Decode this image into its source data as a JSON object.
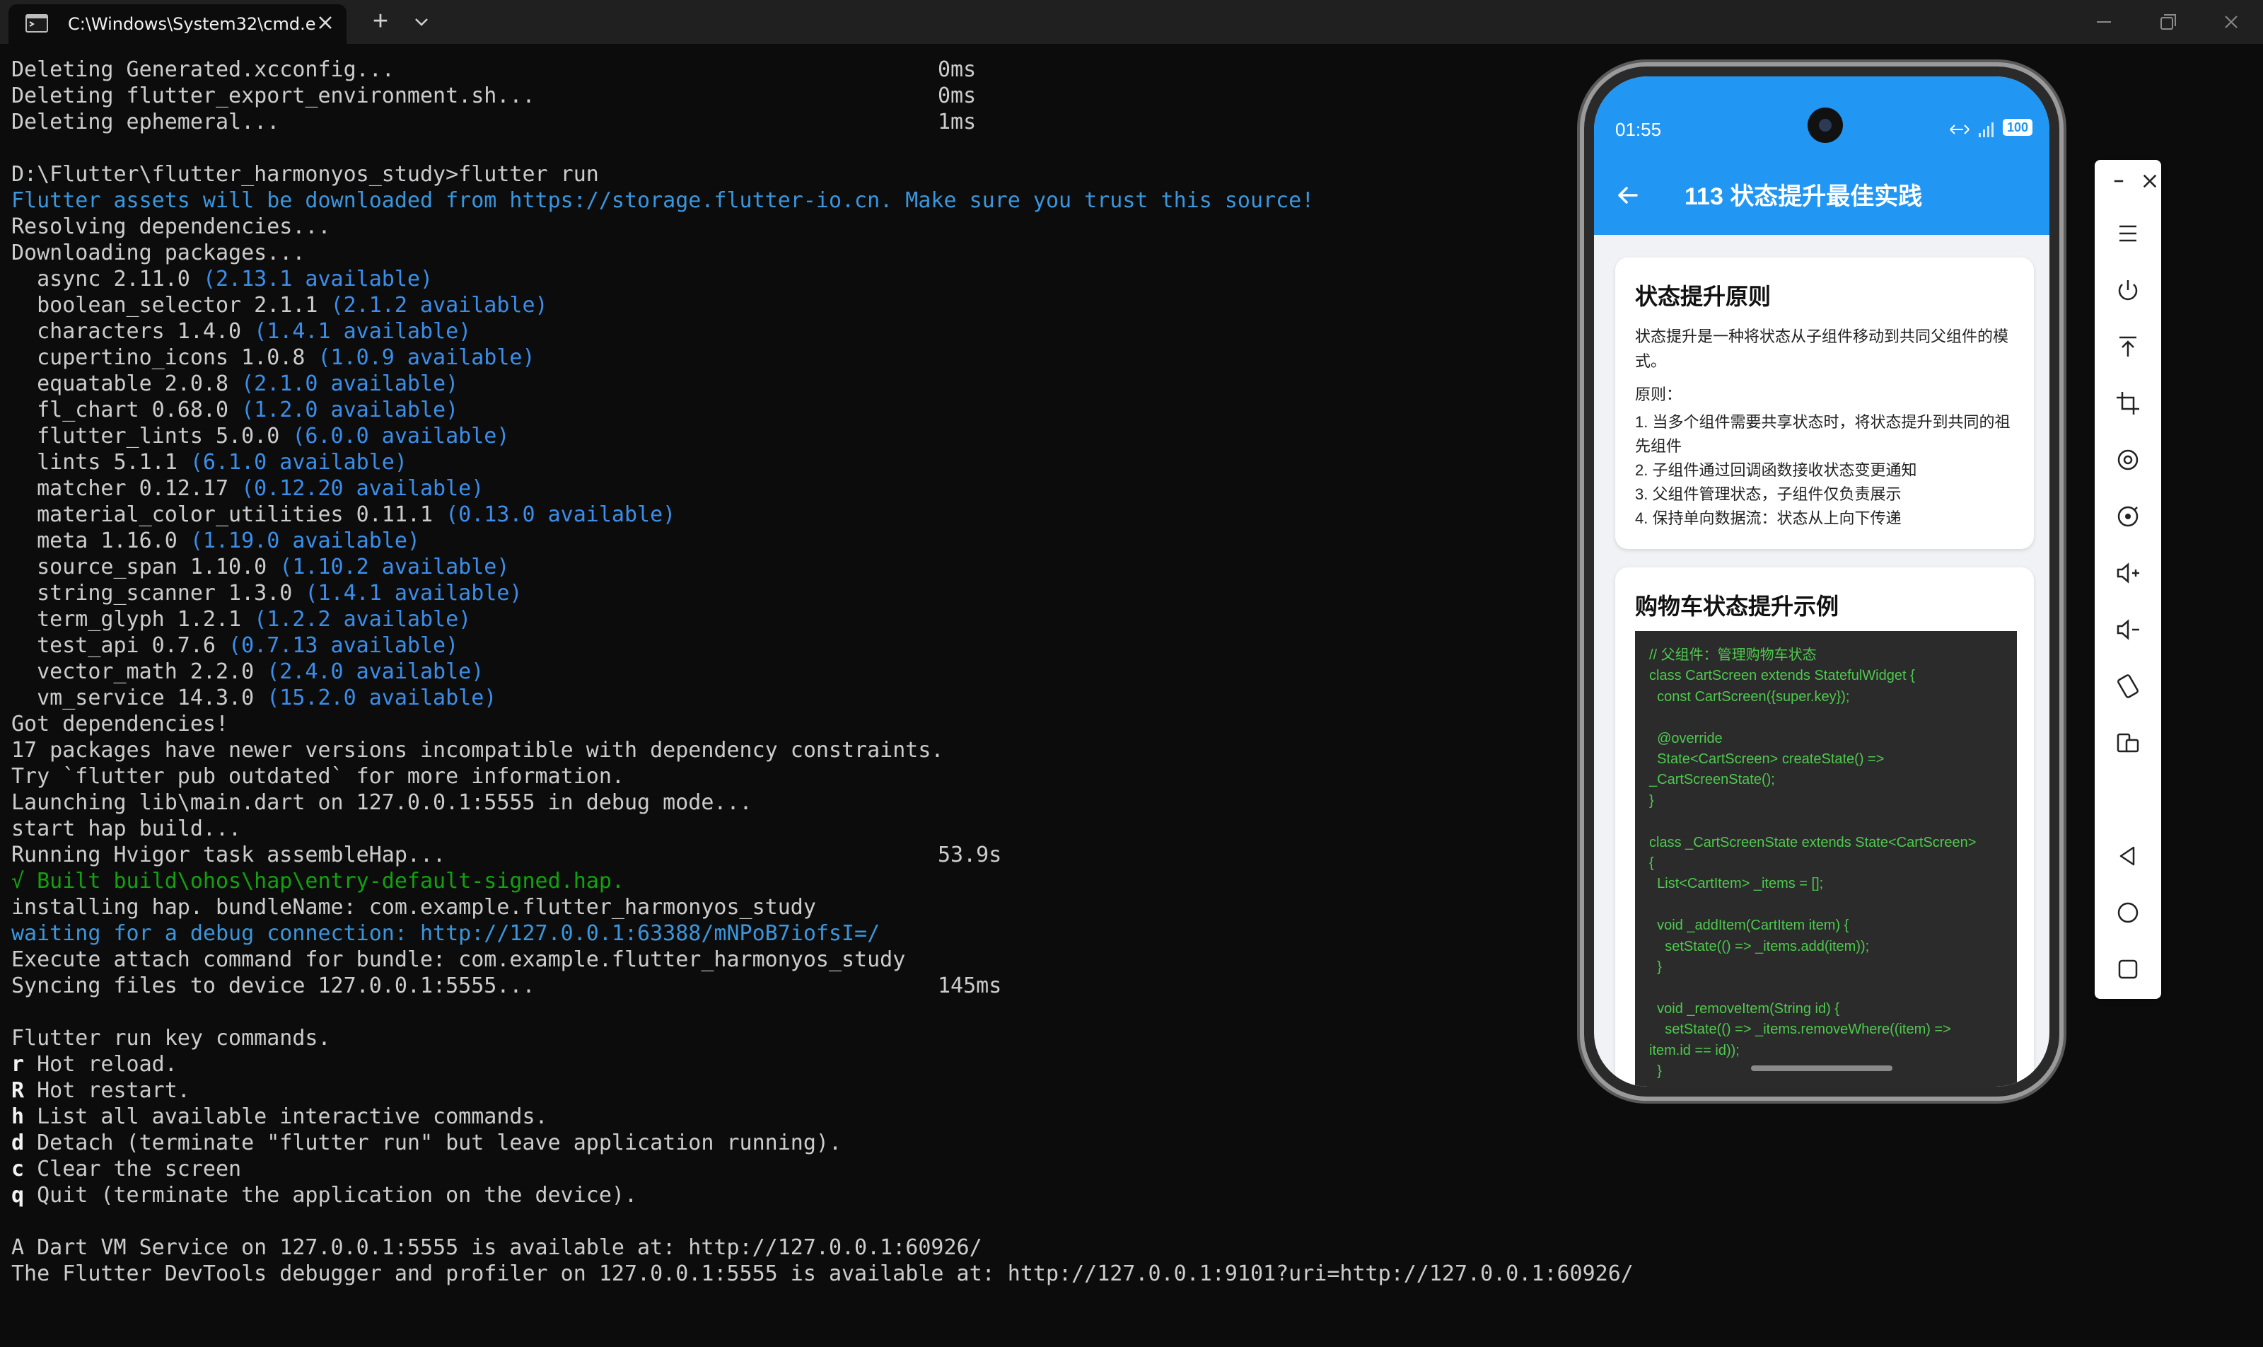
{
  "window": {
    "tab_title": "C:\\Windows\\System32\\cmd.e",
    "tab_icon": "terminal-icon",
    "close_tab_icon": "close-icon",
    "new_tab_label": "+",
    "dropdown_icon": "chevron-down-icon",
    "minimize_icon": "minimize-icon",
    "maximize_icon": "maximize-icon",
    "close_icon": "close-icon"
  },
  "terminal": {
    "colors": {
      "text": "#cccccc",
      "cyan": "#3a96dd",
      "green": "#13a10e",
      "bright": "#f2f2f2",
      "available": "#3b8eea",
      "background": "#0c0c0c"
    },
    "lines": [
      {
        "segments": [
          {
            "text": "Deleting Generated.xcconfig...",
            "style": ""
          }
        ],
        "time": "0ms"
      },
      {
        "segments": [
          {
            "text": "Deleting flutter_export_environment.sh...",
            "style": ""
          }
        ],
        "time": "0ms"
      },
      {
        "segments": [
          {
            "text": "Deleting ephemeral...",
            "style": ""
          }
        ],
        "time": "1ms"
      },
      {
        "segments": [
          {
            "text": "",
            "style": ""
          }
        ],
        "time": ""
      },
      {
        "segments": [
          {
            "text": "D:\\Flutter\\flutter_harmonyos_study>flutter run",
            "style": ""
          }
        ],
        "time": ""
      },
      {
        "segments": [
          {
            "text": "Flutter assets will be downloaded from https://storage.flutter-io.cn. Make sure you trust this source!",
            "style": "cyan"
          }
        ],
        "time": ""
      },
      {
        "segments": [
          {
            "text": "Resolving dependencies...",
            "style": ""
          }
        ],
        "time": ""
      },
      {
        "segments": [
          {
            "text": "Downloading packages...",
            "style": ""
          }
        ],
        "time": ""
      },
      {
        "segments": [
          {
            "text": "  async 2.11.0 ",
            "style": ""
          },
          {
            "text": "(2.13.1 available)",
            "style": "avail"
          }
        ],
        "time": ""
      },
      {
        "segments": [
          {
            "text": "  boolean_selector 2.1.1 ",
            "style": ""
          },
          {
            "text": "(2.1.2 available)",
            "style": "avail"
          }
        ],
        "time": ""
      },
      {
        "segments": [
          {
            "text": "  characters 1.4.0 ",
            "style": ""
          },
          {
            "text": "(1.4.1 available)",
            "style": "avail"
          }
        ],
        "time": ""
      },
      {
        "segments": [
          {
            "text": "  cupertino_icons 1.0.8 ",
            "style": ""
          },
          {
            "text": "(1.0.9 available)",
            "style": "avail"
          }
        ],
        "time": ""
      },
      {
        "segments": [
          {
            "text": "  equatable 2.0.8 ",
            "style": ""
          },
          {
            "text": "(2.1.0 available)",
            "style": "avail"
          }
        ],
        "time": ""
      },
      {
        "segments": [
          {
            "text": "  fl_chart 0.68.0 ",
            "style": ""
          },
          {
            "text": "(1.2.0 available)",
            "style": "avail"
          }
        ],
        "time": ""
      },
      {
        "segments": [
          {
            "text": "  flutter_lints 5.0.0 ",
            "style": ""
          },
          {
            "text": "(6.0.0 available)",
            "style": "avail"
          }
        ],
        "time": ""
      },
      {
        "segments": [
          {
            "text": "  lints 5.1.1 ",
            "style": ""
          },
          {
            "text": "(6.1.0 available)",
            "style": "avail"
          }
        ],
        "time": ""
      },
      {
        "segments": [
          {
            "text": "  matcher 0.12.17 ",
            "style": ""
          },
          {
            "text": "(0.12.20 available)",
            "style": "avail"
          }
        ],
        "time": ""
      },
      {
        "segments": [
          {
            "text": "  material_color_utilities 0.11.1 ",
            "style": ""
          },
          {
            "text": "(0.13.0 available)",
            "style": "avail"
          }
        ],
        "time": ""
      },
      {
        "segments": [
          {
            "text": "  meta 1.16.0 ",
            "style": ""
          },
          {
            "text": "(1.19.0 available)",
            "style": "avail"
          }
        ],
        "time": ""
      },
      {
        "segments": [
          {
            "text": "  source_span 1.10.0 ",
            "style": ""
          },
          {
            "text": "(1.10.2 available)",
            "style": "avail"
          }
        ],
        "time": ""
      },
      {
        "segments": [
          {
            "text": "  string_scanner 1.3.0 ",
            "style": ""
          },
          {
            "text": "(1.4.1 available)",
            "style": "avail"
          }
        ],
        "time": ""
      },
      {
        "segments": [
          {
            "text": "  term_glyph 1.2.1 ",
            "style": ""
          },
          {
            "text": "(1.2.2 available)",
            "style": "avail"
          }
        ],
        "time": ""
      },
      {
        "segments": [
          {
            "text": "  test_api 0.7.6 ",
            "style": ""
          },
          {
            "text": "(0.7.13 available)",
            "style": "avail"
          }
        ],
        "time": ""
      },
      {
        "segments": [
          {
            "text": "  vector_math 2.2.0 ",
            "style": ""
          },
          {
            "text": "(2.4.0 available)",
            "style": "avail"
          }
        ],
        "time": ""
      },
      {
        "segments": [
          {
            "text": "  vm_service 14.3.0 ",
            "style": ""
          },
          {
            "text": "(15.2.0 available)",
            "style": "avail"
          }
        ],
        "time": ""
      },
      {
        "segments": [
          {
            "text": "Got dependencies!",
            "style": ""
          }
        ],
        "time": ""
      },
      {
        "segments": [
          {
            "text": "17 packages have newer versions incompatible with dependency constraints.",
            "style": ""
          }
        ],
        "time": ""
      },
      {
        "segments": [
          {
            "text": "Try `flutter pub outdated` for more information.",
            "style": ""
          }
        ],
        "time": ""
      },
      {
        "segments": [
          {
            "text": "Launching lib\\main.dart on 127.0.0.1:5555 in debug mode...",
            "style": ""
          }
        ],
        "time": ""
      },
      {
        "segments": [
          {
            "text": "start hap build...",
            "style": ""
          }
        ],
        "time": ""
      },
      {
        "segments": [
          {
            "text": "Running Hvigor task assembleHap...",
            "style": ""
          }
        ],
        "time": "53.9s"
      },
      {
        "segments": [
          {
            "text": "√ Built build\\ohos\\hap\\entry-default-signed.hap.",
            "style": "green"
          }
        ],
        "time": ""
      },
      {
        "segments": [
          {
            "text": "installing hap. bundleName: com.example.flutter_harmonyos_study",
            "style": ""
          }
        ],
        "time": ""
      },
      {
        "segments": [
          {
            "text": "waiting for a debug connection: http://127.0.0.1:63388/mNPoB7iofsI=/",
            "style": "cyan"
          }
        ],
        "time": ""
      },
      {
        "segments": [
          {
            "text": "Execute attach command for bundle: com.example.flutter_harmonyos_study",
            "style": ""
          }
        ],
        "time": ""
      },
      {
        "segments": [
          {
            "text": "Syncing files to device 127.0.0.1:5555...",
            "style": ""
          }
        ],
        "time": "145ms"
      },
      {
        "segments": [
          {
            "text": "",
            "style": ""
          }
        ],
        "time": ""
      },
      {
        "segments": [
          {
            "text": "Flutter run key commands.",
            "style": ""
          }
        ],
        "time": ""
      },
      {
        "segments": [
          {
            "text": "r",
            "style": "bright"
          },
          {
            "text": " Hot reload.",
            "style": ""
          }
        ],
        "time": ""
      },
      {
        "segments": [
          {
            "text": "R",
            "style": "bright"
          },
          {
            "text": " Hot restart.",
            "style": ""
          }
        ],
        "time": ""
      },
      {
        "segments": [
          {
            "text": "h",
            "style": "bright"
          },
          {
            "text": " List all available interactive commands.",
            "style": ""
          }
        ],
        "time": ""
      },
      {
        "segments": [
          {
            "text": "d",
            "style": "bright"
          },
          {
            "text": " Detach (terminate \"flutter run\" but leave application running).",
            "style": ""
          }
        ],
        "time": ""
      },
      {
        "segments": [
          {
            "text": "c",
            "style": "bright"
          },
          {
            "text": " Clear the screen",
            "style": ""
          }
        ],
        "time": ""
      },
      {
        "segments": [
          {
            "text": "q",
            "style": "bright"
          },
          {
            "text": " Quit (terminate the application on the device).",
            "style": ""
          }
        ],
        "time": ""
      },
      {
        "segments": [
          {
            "text": "",
            "style": ""
          }
        ],
        "time": ""
      },
      {
        "segments": [
          {
            "text": "A Dart VM Service on 127.0.0.1:5555 is available at: http://127.0.0.1:60926/",
            "style": ""
          }
        ],
        "time": ""
      },
      {
        "segments": [
          {
            "text": "The Flutter DevTools debugger and profiler on 127.0.0.1:5555 is available at: http://127.0.0.1:9101?uri=http://127.0.0.1:60926/",
            "style": ""
          }
        ],
        "time": ""
      }
    ]
  },
  "phone": {
    "status_time": "01:55",
    "battery": "100",
    "accent_color": "#2196f3",
    "app_title": "113 状态提升最佳实践",
    "back_icon": "arrow-left-icon",
    "card1": {
      "title": "状态提升原则",
      "intro": "状态提升是一种将状态从子组件移动到共同父组件的模式。",
      "rules_heading": "原则：",
      "rules": [
        "1. 当多个组件需要共享状态时，将状态提升到共同的祖先组件",
        "2. 子组件通过回调函数接收状态变更通知",
        "3. 父组件管理状态，子组件仅负责展示",
        "4. 保持单向数据流：状态从上向下传递"
      ]
    },
    "card2": {
      "title": "购物车状态提升示例",
      "code_color": "#4ec94e",
      "code": "// 父组件：管理购物车状态\nclass CartScreen extends StatefulWidget {\n  const CartScreen({super.key});\n\n  @override\n  State<CartScreen> createState() =>\n_CartScreenState();\n}\n\nclass _CartScreenState extends State<CartScreen>\n{\n  List<CartItem> _items = [];\n\n  void _addItem(CartItem item) {\n    setState(() => _items.add(item));\n  }\n\n  void _removeItem(String id) {\n    setState(() => _items.removeWhere((item) =>\nitem.id == id));\n  }\n\n  @override"
    }
  },
  "toolbar": {
    "items": [
      {
        "name": "minimize-icon"
      },
      {
        "name": "close-icon"
      },
      {
        "name": "menu-icon"
      },
      {
        "name": "power-icon"
      },
      {
        "name": "pin-top-icon"
      },
      {
        "name": "crop-icon"
      },
      {
        "name": "rotate-icon"
      },
      {
        "name": "screenshot-icon"
      },
      {
        "name": "volume-up-icon"
      },
      {
        "name": "volume-down-icon"
      },
      {
        "name": "rotate-device-icon"
      },
      {
        "name": "fold-icon"
      },
      {
        "name": "back-icon"
      },
      {
        "name": "home-icon"
      },
      {
        "name": "recents-icon"
      }
    ]
  }
}
